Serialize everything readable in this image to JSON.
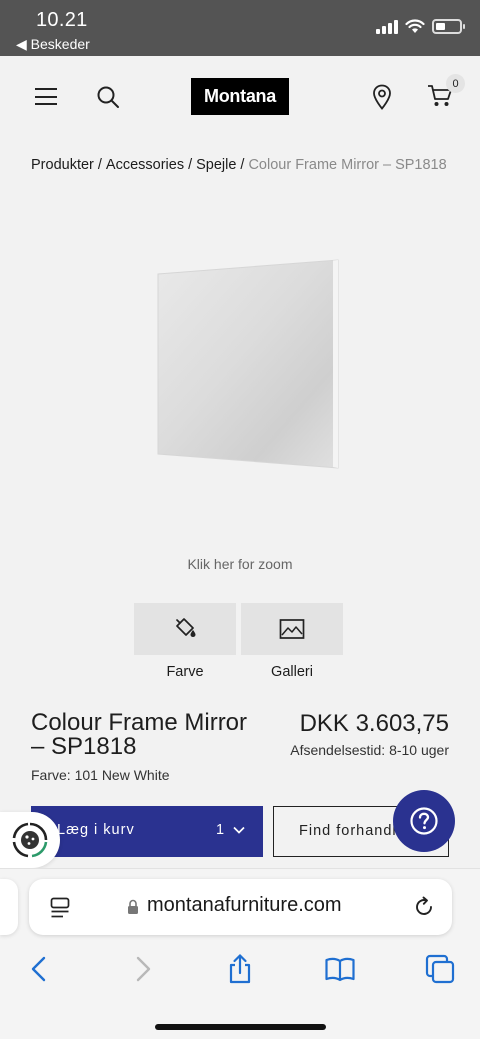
{
  "status_bar": {
    "time": "10.21",
    "back_label": "◀ Beskeder"
  },
  "header": {
    "logo_text": "Montana",
    "cart_count": "0"
  },
  "breadcrumb": {
    "items": [
      "Produkter",
      "Accessories",
      "Spejle"
    ],
    "separator": "/",
    "current": "Colour Frame Mirror – SP1818"
  },
  "gallery": {
    "zoom_hint": "Klik her for zoom",
    "tabs": [
      {
        "label": "Farve",
        "icon": "paint-bucket-icon"
      },
      {
        "label": "Galleri",
        "icon": "image-icon"
      }
    ]
  },
  "product": {
    "title": "Colour Frame Mirror – SP1818",
    "price": "DKK 3.603,75",
    "shipping": "Afsendelsestid: 8-10 uger",
    "color": "Farve: 101 New White"
  },
  "actions": {
    "add_to_cart": "Læg i kurv",
    "quantity": "1",
    "find_dealer": "Find forhandler"
  },
  "browser": {
    "url": "montanafurniture.com"
  },
  "colors": {
    "brand_blue": "#2a3290",
    "status_bar": "#545454",
    "background": "#f2f2f2"
  }
}
